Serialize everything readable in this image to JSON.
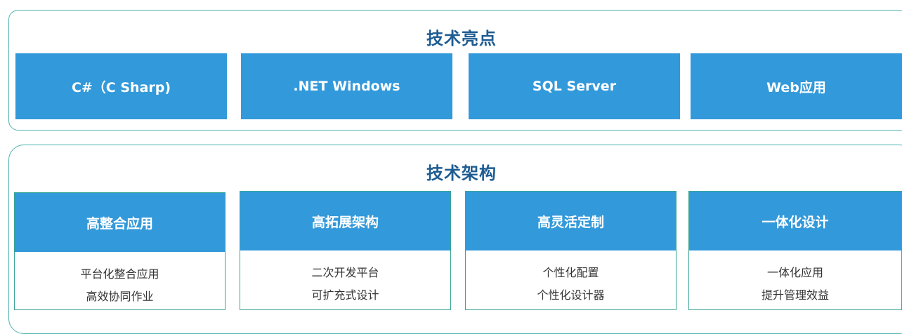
{
  "highlights": {
    "title": "技术亮点",
    "items": [
      {
        "label": "C#（C Sharp)"
      },
      {
        "label": ".NET Windows"
      },
      {
        "label": "SQL Server"
      },
      {
        "label": "Web应用"
      }
    ]
  },
  "architecture": {
    "title": "技术架构",
    "items": [
      {
        "title": "高整合应用",
        "lines": [
          "平台化整合应用",
          "高效协同作业"
        ]
      },
      {
        "title": "高拓展架构",
        "lines": [
          "二次开发平台",
          "可扩充式设计"
        ]
      },
      {
        "title": "高灵活定制",
        "lines": [
          "个性化配置",
          "个性化设计器"
        ]
      },
      {
        "title": "一体化设计",
        "lines": [
          "一体化应用",
          "提升管理效益"
        ]
      }
    ]
  },
  "colors": {
    "box_blue": "#3299da",
    "title_blue": "#1e5c92",
    "border_teal": "#4fb3b0"
  }
}
